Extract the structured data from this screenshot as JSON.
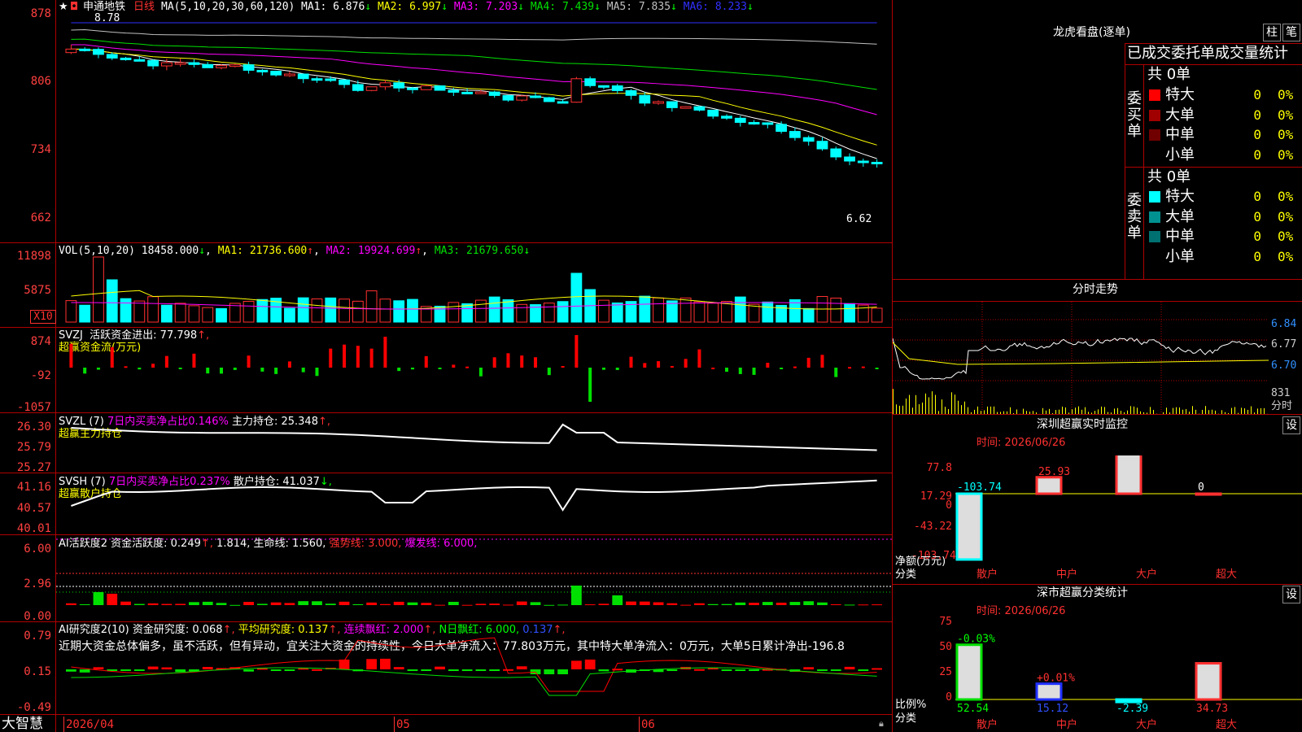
{
  "stock": {
    "name": "申通地铁",
    "period": "日线",
    "high_mark": "8.78",
    "low_mark": "6.62"
  },
  "main": {
    "ma_header": "MA(5,10,20,30,60,120)",
    "mas": [
      {
        "label": "MA1:",
        "value": "6.876",
        "arrow": "↓",
        "color": "#ffffff"
      },
      {
        "label": "MA2:",
        "value": "6.997",
        "arrow": "↓",
        "color": "#ffff00"
      },
      {
        "label": "MA3:",
        "value": "7.203",
        "arrow": "↓",
        "color": "#ff00ff"
      },
      {
        "label": "MA4:",
        "value": "7.439",
        "arrow": "↓",
        "color": "#00e000"
      },
      {
        "label": "MA5:",
        "value": "7.835",
        "arrow": "↓",
        "color": "#c0c0c0"
      },
      {
        "label": "MA6:",
        "value": "8.233",
        "arrow": "↓",
        "color": "#3030ff"
      }
    ],
    "axis": [
      "878",
      "806",
      "734",
      "662"
    ]
  },
  "vol": {
    "header": "VOL(5,10,20)",
    "value": "18458.000",
    "arrow": "↓",
    "ma1": "MA1: 21736.600",
    "ma1_arrow": "↑",
    "ma2": "MA2: 19924.699",
    "ma2_arrow": "↑",
    "ma3": "MA3: 21679.650",
    "ma3_arrow": "↓",
    "axis": [
      "11898",
      "5875"
    ],
    "unit": "X10"
  },
  "svzj": {
    "label": "SVZJ",
    "title": "活跃资金进出: 77.798",
    "arrow": "↑,",
    "sub": "超赢资金流(万元)",
    "axis": [
      "874",
      "-92",
      "-1057"
    ]
  },
  "svzl": {
    "label": "SVZL (7)",
    "ratio": "7日内买卖净占比0.146%",
    "hold": "主力持仓: 25.348",
    "arrow": "↑,",
    "sub": "超赢主力持仓",
    "axis": [
      "26.30",
      "25.79",
      "25.27"
    ]
  },
  "svsh": {
    "label": "SVSH (7)",
    "ratio": "7日内买卖净占比0.237%",
    "hold": "散户持仓: 41.037",
    "arrow": "↓,",
    "sub": "超赢散户持仓",
    "axis": [
      "41.16",
      "40.57",
      "40.01"
    ]
  },
  "active": {
    "label": "AI活跃度2",
    "a": "资金活跃度: 0.249",
    "a_arrow": "↑,",
    "b": "1.814,",
    "c": "生命线: 1.560,",
    "d": "强势线: 3.000,",
    "e": "爆发线: 6.000,",
    "axis": [
      "6.00",
      "2.96",
      "0.00"
    ]
  },
  "research": {
    "label": "AI研究度2(10)",
    "a": "资金研究度: 0.068",
    "a_arrow": "↑,",
    "b": "平均研究度: 0.137",
    "b_arrow": "↑,",
    "c": "连续飘红: 2.000",
    "c_arrow": "↑,",
    "d": "N日飘红: 6.000,",
    "e": "0.137",
    "e_arrow": "↑,",
    "comment": "近期大资金总体偏多，虽不活跃，但有异动，宜关注大资金的持续性，今日大单净流入：77.803万元，其中特大单净流入：0万元，大单5日累计净出-196.8",
    "axis": [
      "0.79",
      "0.15",
      "-0.49"
    ]
  },
  "xaxis": {
    "brand": "大智慧",
    "date1": "2026/04",
    "m5": "05",
    "m6": "06"
  },
  "right": {
    "title": "龙虎看盘(逐单)",
    "btn1": "柱",
    "btn2": "笔",
    "stat_title": "已成交委托单成交量统计",
    "buy": {
      "side": "委买单",
      "total": "共 0单",
      "rows": [
        {
          "name": "特大",
          "v1": "0",
          "v2": "0%",
          "color": "#ff0000"
        },
        {
          "name": "大单",
          "v1": "0",
          "v2": "0%",
          "color": "#a00000"
        },
        {
          "name": "中单",
          "v1": "0",
          "v2": "0%",
          "color": "#700000"
        },
        {
          "name": "小单",
          "v1": "0",
          "v2": "0%",
          "color": "#000000"
        }
      ]
    },
    "sell": {
      "side": "委卖单",
      "total": "共 0单",
      "rows": [
        {
          "name": "特大",
          "v1": "0",
          "v2": "0%",
          "color": "#00ffff"
        },
        {
          "name": "大单",
          "v1": "0",
          "v2": "0%",
          "color": "#009090"
        },
        {
          "name": "中单",
          "v1": "0",
          "v2": "0%",
          "color": "#007070"
        },
        {
          "name": "小单",
          "v1": "0",
          "v2": "0%",
          "color": "#000000"
        }
      ]
    },
    "minute": {
      "title": "分时走势",
      "axis": [
        "6.84",
        "6.77",
        "6.70"
      ],
      "vol": "831",
      "vlabel": "分时"
    },
    "sz": {
      "title": "深圳超赢实时监控",
      "btn": "设",
      "time": "时间: 2026/06/26",
      "axis": [
        "77.8",
        "17.29",
        "0",
        "-43.22",
        "-103.74"
      ],
      "unit": "净额(万元)",
      "cat_label": "分类",
      "chart_data": {
        "type": "bar",
        "categories": [
          "散户",
          "中户",
          "大户",
          "超大"
        ],
        "values": [
          -103.74,
          25.93,
          77.8,
          0
        ],
        "ylim": [
          -103.74,
          77.8
        ]
      }
    },
    "szc": {
      "title": "深市超赢分类统计",
      "btn": "设",
      "time": "时间: 2026/06/26",
      "axis": [
        "75",
        "50",
        "25",
        "0"
      ],
      "unit": "比例%",
      "cat_label": "分类",
      "chart_data": {
        "type": "bar",
        "categories": [
          "散户",
          "中户",
          "大户",
          "超大"
        ],
        "values": [
          52.54,
          15.12,
          -2.39,
          34.73
        ],
        "changes": [
          "-0.03%",
          "+0.01%",
          "",
          ""
        ],
        "ylim": [
          0,
          75
        ]
      }
    }
  }
}
